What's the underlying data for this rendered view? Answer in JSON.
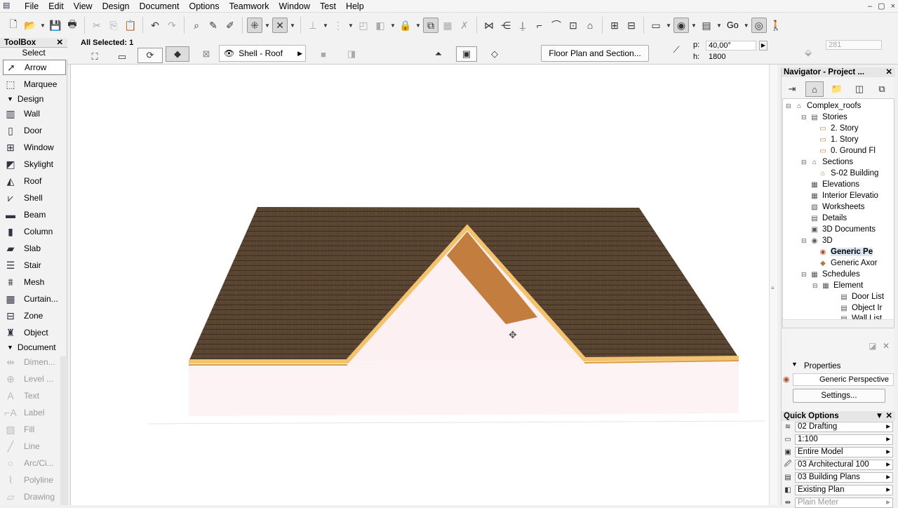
{
  "menubar": {
    "items": [
      "File",
      "Edit",
      "View",
      "Design",
      "Document",
      "Options",
      "Teamwork",
      "Window",
      "Test",
      "Help"
    ],
    "window_controls": [
      "–",
      "▢",
      "×"
    ]
  },
  "toolbar": {
    "go_label": "Go"
  },
  "infobox": {
    "all_selected": "All Selected: 1",
    "shell_roof": "Shell - Roof",
    "floor_plan_section": "Floor Plan and Section...",
    "p_label": "p:",
    "p_value": "40,00°",
    "h_label": "h:",
    "h_value": "1800",
    "number_field": "281"
  },
  "toolbox": {
    "title": "ToolBox",
    "select_label": "Select",
    "select_tools": [
      {
        "label": "Arrow",
        "icon": "arrow-icon"
      },
      {
        "label": "Marquee",
        "icon": "marquee-icon"
      }
    ],
    "design_group": "Design",
    "design_tools": [
      {
        "label": "Wall",
        "icon": "wall-icon"
      },
      {
        "label": "Door",
        "icon": "door-icon"
      },
      {
        "label": "Window",
        "icon": "window-icon"
      },
      {
        "label": "Skylight",
        "icon": "skylight-icon"
      },
      {
        "label": "Roof",
        "icon": "roof-icon"
      },
      {
        "label": "Shell",
        "icon": "shell-icon"
      },
      {
        "label": "Beam",
        "icon": "beam-icon"
      },
      {
        "label": "Column",
        "icon": "column-icon"
      },
      {
        "label": "Slab",
        "icon": "slab-icon"
      },
      {
        "label": "Stair",
        "icon": "stair-icon"
      },
      {
        "label": "Mesh",
        "icon": "mesh-icon"
      },
      {
        "label": "Curtain...",
        "icon": "curtain-wall-icon"
      },
      {
        "label": "Zone",
        "icon": "zone-icon"
      },
      {
        "label": "Object",
        "icon": "object-icon"
      }
    ],
    "document_group": "Document",
    "document_tools": [
      {
        "label": "Dimen...",
        "icon": "dimension-icon"
      },
      {
        "label": "Level ...",
        "icon": "level-icon"
      },
      {
        "label": "Text",
        "icon": "text-icon"
      },
      {
        "label": "Label",
        "icon": "label-icon"
      },
      {
        "label": "Fill",
        "icon": "fill-icon"
      },
      {
        "label": "Line",
        "icon": "line-icon"
      },
      {
        "label": "Arc/Ci...",
        "icon": "arc-icon"
      },
      {
        "label": "Polyline",
        "icon": "polyline-icon"
      },
      {
        "label": "Drawing",
        "icon": "drawing-icon"
      }
    ]
  },
  "navigator": {
    "title": "Navigator - Project ...",
    "tree": [
      {
        "label": "Complex_roofs",
        "icon": "project-icon"
      },
      {
        "label": "Stories",
        "icon": "stories-icon"
      },
      {
        "label": "2. Story",
        "icon": "story-icon"
      },
      {
        "label": "1. Story",
        "icon": "story-icon"
      },
      {
        "label": "0. Ground Fl",
        "icon": "story-icon"
      },
      {
        "label": "Sections",
        "icon": "sections-icon"
      },
      {
        "label": "S-02 Building",
        "icon": "section-icon"
      },
      {
        "label": "Elevations",
        "icon": "elevations-icon"
      },
      {
        "label": "Interior Elevatio",
        "icon": "interior-elevation-icon"
      },
      {
        "label": "Worksheets",
        "icon": "worksheets-icon"
      },
      {
        "label": "Details",
        "icon": "details-icon"
      },
      {
        "label": "3D Documents",
        "icon": "3d-documents-icon"
      },
      {
        "label": "3D",
        "icon": "3d-icon"
      },
      {
        "label": "Generic Pe",
        "icon": "perspective-icon"
      },
      {
        "label": "Generic Axor",
        "icon": "axonometry-icon"
      },
      {
        "label": "Schedules",
        "icon": "schedules-icon"
      },
      {
        "label": "Element",
        "icon": "element-icon"
      },
      {
        "label": "Door List",
        "icon": "list-icon"
      },
      {
        "label": "Object Ir",
        "icon": "list-icon"
      },
      {
        "label": "Wall List",
        "icon": "list-icon"
      }
    ],
    "properties_label": "Properties",
    "properties_value": "Generic Perspective",
    "settings_button": "Settings..."
  },
  "quick_options": {
    "title": "Quick Options",
    "items": [
      {
        "label": "02 Drafting",
        "icon": "layer-icon"
      },
      {
        "label": "1:100",
        "icon": "scale-icon"
      },
      {
        "label": "Entire Model",
        "icon": "model-icon"
      },
      {
        "label": "03 Architectural 100",
        "icon": "pen-set-icon"
      },
      {
        "label": "03 Building Plans",
        "icon": "model-view-icon"
      },
      {
        "label": "Existing Plan",
        "icon": "renovation-icon"
      },
      {
        "label": "Plain Meter",
        "icon": "dimension-style-icon"
      }
    ]
  }
}
